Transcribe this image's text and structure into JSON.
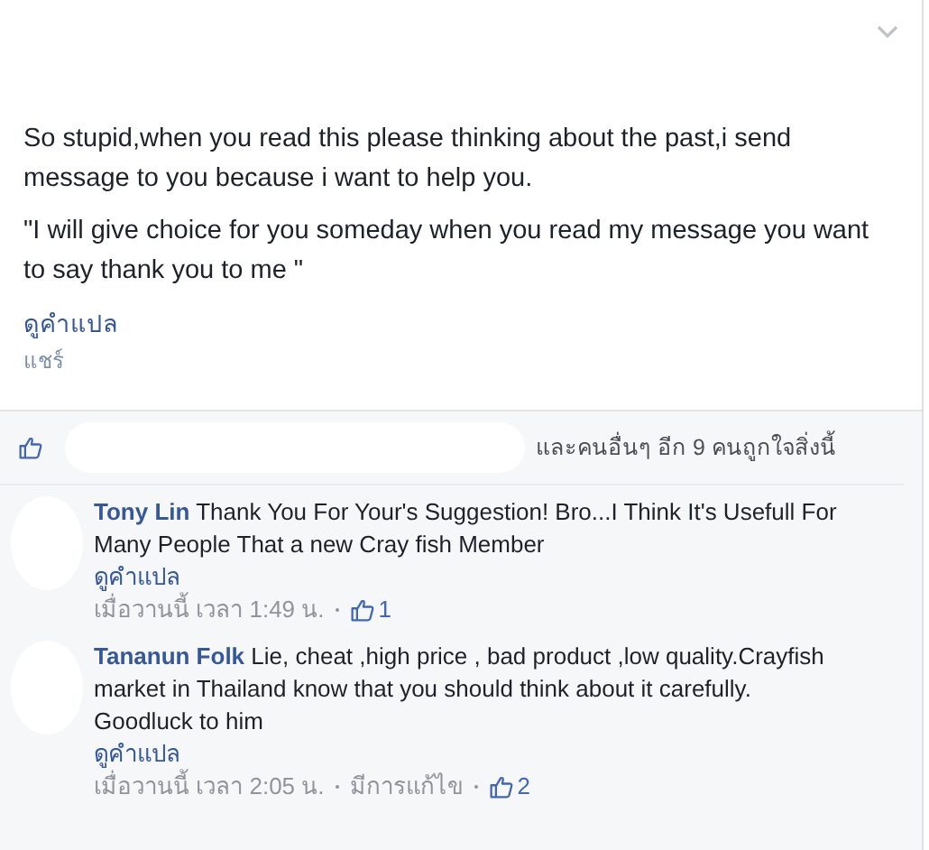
{
  "post": {
    "paragraphs": [
      "So stupid,when you read this please thinking about the past,i send message to you because i want to help you.",
      "\"I will give choice for you someday when you read my message you want to say thank you to me \""
    ],
    "translate_link": "ดูคำแปล",
    "share_link": "แชร์"
  },
  "likes": {
    "text": "และคนอื่นๆ อีก 9 คนถูกใจสิ่งนี้"
  },
  "comments": [
    {
      "author": "Tony Lin",
      "text": "Thank You For Your's Suggestion! Bro...I Think It's Usefull For Many People That a new Cray fish Member",
      "translate_link": "ดูคำแปล",
      "time": "เมื่อวานนี้ เวลา 1:49 น.",
      "like_count": "1"
    },
    {
      "author": "Tananun Folk",
      "text": "Lie, cheat ,high price , bad product ,low quality.Crayfish market in Thailand know that you should think about it carefully.\nGoodluck to him",
      "translate_link": "ดูคำแปล",
      "time": "เมื่อวานนี้ เวลา 2:05 น.",
      "edited": "มีการแก้ไข",
      "like_count": "2"
    }
  ]
}
